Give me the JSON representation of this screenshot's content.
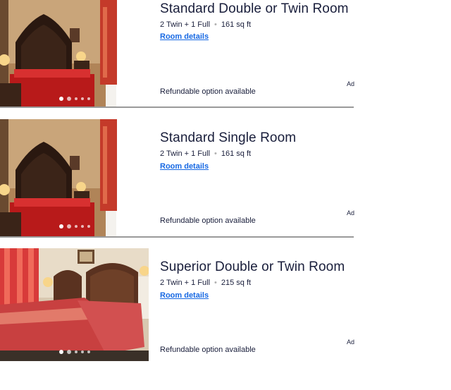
{
  "rooms": [
    {
      "name": "Standard Double or Twin Room",
      "beds": "2 Twin + 1 Full",
      "size": "161 sq ft",
      "details_link": "Room details",
      "refund_text": "Refundable option available",
      "ad_text": "Ad",
      "photo": "bedroom-dark-headboard",
      "carousel_count": 5,
      "carousel_active": 1
    },
    {
      "name": "Standard Single Room",
      "beds": "2 Twin + 1 Full",
      "size": "161 sq ft",
      "details_link": "Room details",
      "refund_text": "Refundable option available",
      "ad_text": "Ad",
      "photo": "bedroom-dark-headboard",
      "carousel_count": 5,
      "carousel_active": 1
    },
    {
      "name": "Superior Double or Twin Room",
      "beds": "2 Twin + 1 Full",
      "size": "215 sq ft",
      "details_link": "Room details",
      "refund_text": "Refundable option available",
      "ad_text": "Ad",
      "photo": "bedroom-twin-beds",
      "carousel_count": 5,
      "carousel_active": 1
    }
  ],
  "colors": {
    "title": "#191e3b",
    "link": "#1668e3",
    "separator": "#9a9a9a"
  }
}
